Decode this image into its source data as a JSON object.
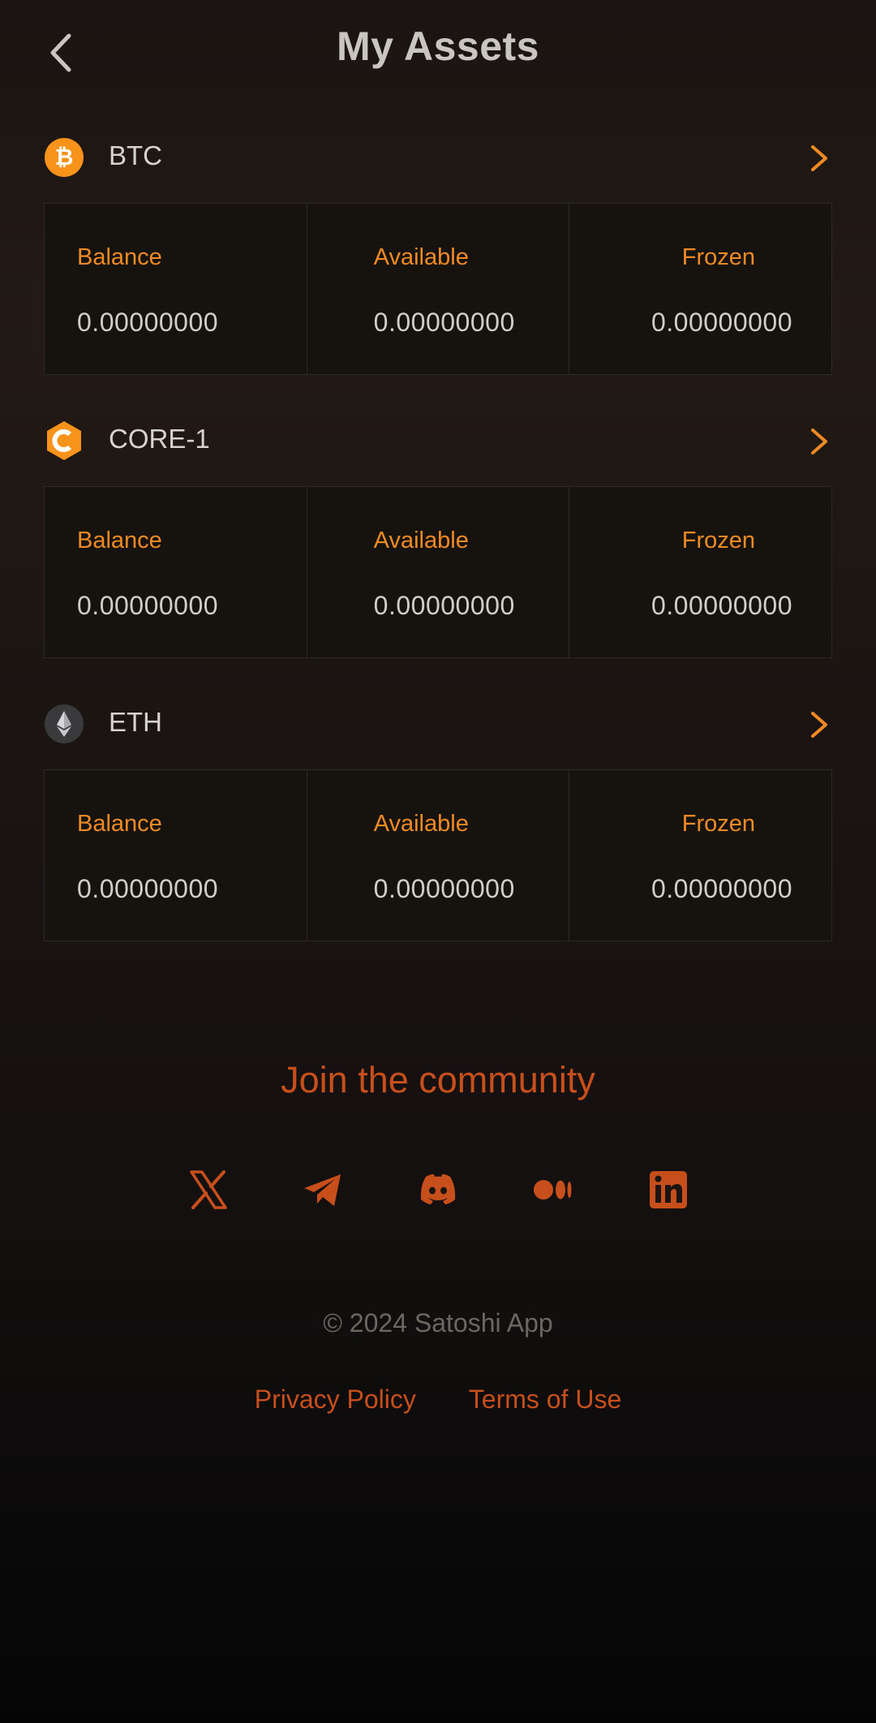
{
  "header": {
    "title": "My Assets",
    "back_icon": "chevron-left-icon"
  },
  "colors": {
    "accent": "#f08a24",
    "community": "#c64f1c",
    "background": "#1a1412"
  },
  "assets": [
    {
      "name": "BTC",
      "icon": "bitcoin-icon",
      "balance_label": "Balance",
      "balance": "0.00000000",
      "available_label": "Available",
      "available": "0.00000000",
      "frozen_label": "Frozen",
      "frozen": "0.00000000"
    },
    {
      "name": "CORE-1",
      "icon": "core-icon",
      "balance_label": "Balance",
      "balance": "0.00000000",
      "available_label": "Available",
      "available": "0.00000000",
      "frozen_label": "Frozen",
      "frozen": "0.00000000"
    },
    {
      "name": "ETH",
      "icon": "ethereum-icon",
      "balance_label": "Balance",
      "balance": "0.00000000",
      "available_label": "Available",
      "available": "0.00000000",
      "frozen_label": "Frozen",
      "frozen": "0.00000000"
    }
  ],
  "community": {
    "title": "Join the community",
    "socials": [
      "x-icon",
      "telegram-icon",
      "discord-icon",
      "medium-icon",
      "linkedin-icon"
    ]
  },
  "footer": {
    "copyright": "© 2024 Satoshi App",
    "privacy": "Privacy Policy",
    "terms": "Terms of Use"
  }
}
